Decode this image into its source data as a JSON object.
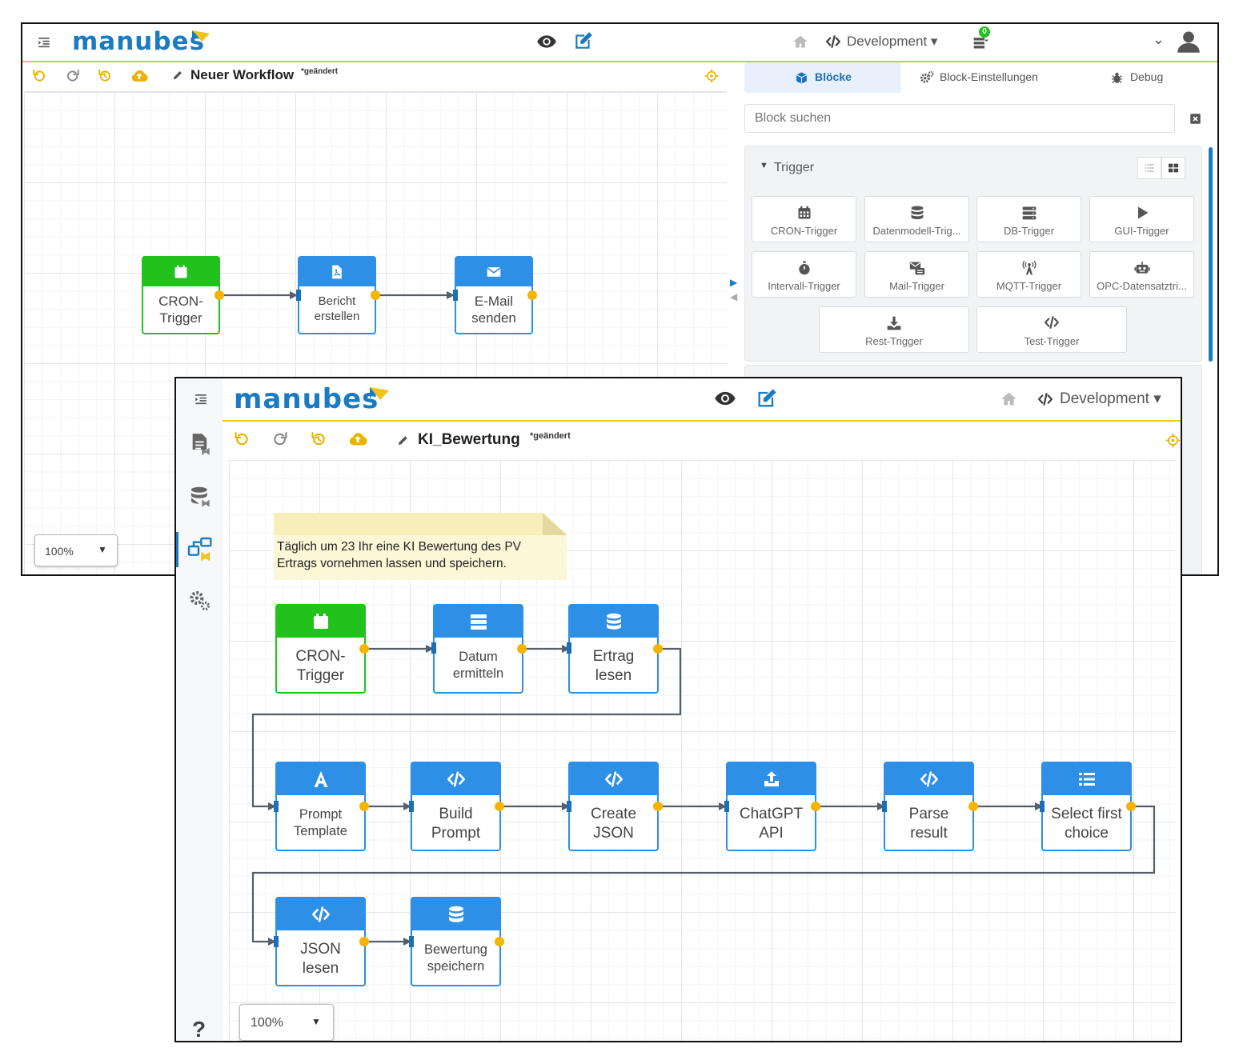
{
  "app": {
    "logo_text": "manubes",
    "brand_color": "#1b7bc2",
    "accent_color": "#f0c419",
    "node_blue": "#2d8fe6",
    "node_green": "#21c21c"
  },
  "back": {
    "header": {
      "environment": "Development",
      "notification_count": "0"
    },
    "toolbar": {
      "workflow_title": "Neuer Workflow",
      "changed_marker": "*geändert"
    },
    "panel": {
      "tabs": [
        {
          "label": "Blöcke",
          "active": true
        },
        {
          "label": "Block-Einstellungen",
          "active": false
        },
        {
          "label": "Debug",
          "active": false
        }
      ],
      "search_placeholder": "Block suchen",
      "section_title": "Trigger",
      "blocks": [
        {
          "label": "CRON-Trigger",
          "icon": "calendar-icon"
        },
        {
          "label": "Datenmodell-Trig...",
          "icon": "database-icon"
        },
        {
          "label": "DB-Trigger",
          "icon": "server-icon"
        },
        {
          "label": "GUI-Trigger",
          "icon": "play-icon"
        },
        {
          "label": "Intervall-Trigger",
          "icon": "stopwatch-icon"
        },
        {
          "label": "Mail-Trigger",
          "icon": "mail-trigger-icon"
        },
        {
          "label": "MQTT-Trigger",
          "icon": "antenna-icon"
        },
        {
          "label": "OPC-Datensatztri...",
          "icon": "robot-icon"
        },
        {
          "label": "Rest-Trigger",
          "icon": "download-icon"
        },
        {
          "label": "Test-Trigger",
          "icon": "code-icon"
        }
      ]
    },
    "zoom": "100%",
    "nodes": [
      {
        "label": "CRON-\nTrigger",
        "icon": "calendar-icon",
        "type": "trigger"
      },
      {
        "label": "Bericht\nerstellen",
        "icon": "pdf-file-icon",
        "type": "action"
      },
      {
        "label": "E-Mail\nsenden",
        "icon": "envelope-icon",
        "type": "action"
      }
    ]
  },
  "front": {
    "header": {
      "environment": "Development"
    },
    "toolbar": {
      "workflow_title": "KI_Bewertung",
      "changed_marker": "*geändert"
    },
    "note": "Täglich um 23 Ihr eine KI Bewertung des PV\nErtrags vornehmen lassen und speichern.",
    "zoom": "100%",
    "help": "?",
    "nodes": [
      {
        "label": "CRON-\nTrigger",
        "icon": "calendar-icon",
        "type": "trigger"
      },
      {
        "label": "Datum\nermitteln",
        "icon": "server-icon",
        "type": "action"
      },
      {
        "label": "Ertrag\nlesen",
        "icon": "database-icon",
        "type": "action"
      },
      {
        "label": "Prompt\nTemplate",
        "icon": "letter-a-icon",
        "type": "action"
      },
      {
        "label": "Build\nPrompt",
        "icon": "code-icon",
        "type": "action"
      },
      {
        "label": "Create\nJSON",
        "icon": "code-icon",
        "type": "action"
      },
      {
        "label": "ChatGPT\nAPI",
        "icon": "upload-icon",
        "type": "action"
      },
      {
        "label": "Parse\nresult",
        "icon": "code-icon",
        "type": "action"
      },
      {
        "label": "Select first\nchoice",
        "icon": "list-icon",
        "type": "action"
      },
      {
        "label": "JSON\nlesen",
        "icon": "code-icon",
        "type": "action"
      },
      {
        "label": "Bewertung\nspeichern",
        "icon": "database-icon",
        "type": "action"
      }
    ]
  }
}
